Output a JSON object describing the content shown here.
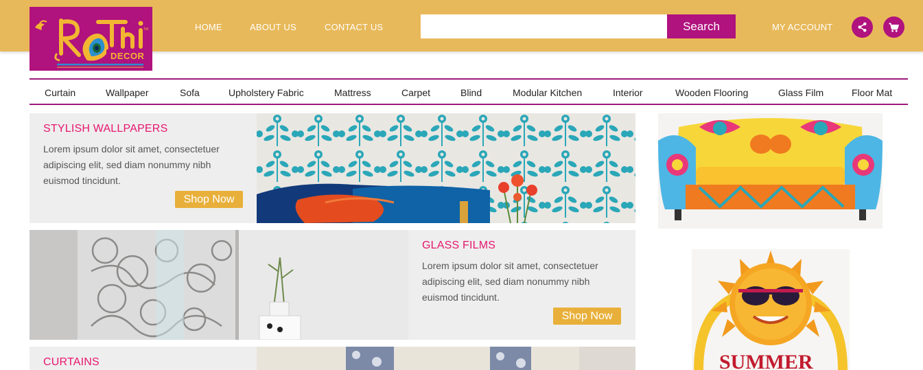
{
  "brand": {
    "logo_lettering": "Rathi DECOR",
    "colors": {
      "header": "#e8b95a",
      "magenta": "#b0127e",
      "title_pink": "#e6166e",
      "button_gold": "#e8b03a"
    }
  },
  "header": {
    "nav": [
      "HOME",
      "ABOUT US",
      "CONTACT US"
    ],
    "search": {
      "placeholder": "",
      "button_label": "Search"
    },
    "account_label": "MY ACCOUNT",
    "icons": [
      "share-icon",
      "cart-icon"
    ]
  },
  "categories": [
    "Curtain",
    "Wallpaper",
    "Sofa",
    "Upholstery Fabric",
    "Mattress",
    "Carpet",
    "Blind",
    "Modular Kitchen",
    "Interior",
    "Wooden Flooring",
    "Glass Film",
    "Floor Mat"
  ],
  "promos": [
    {
      "title": "STYLISH WALLPAPERS",
      "desc": "Lorem ipsum dolor sit amet, consectetuer adipiscing elit, sed diam nonummy nibh euismod tincidunt.",
      "button": "Shop Now"
    },
    {
      "title": "GLASS FILMS",
      "desc": "Lorem ipsum dolor sit amet, consectetuer adipiscing elit, sed diam nonummy nibh euismod tincidunt.",
      "button": "Shop Now"
    },
    {
      "title": "CURTAINS"
    }
  ],
  "sidebar": {
    "summer_text": "SUMMER"
  }
}
